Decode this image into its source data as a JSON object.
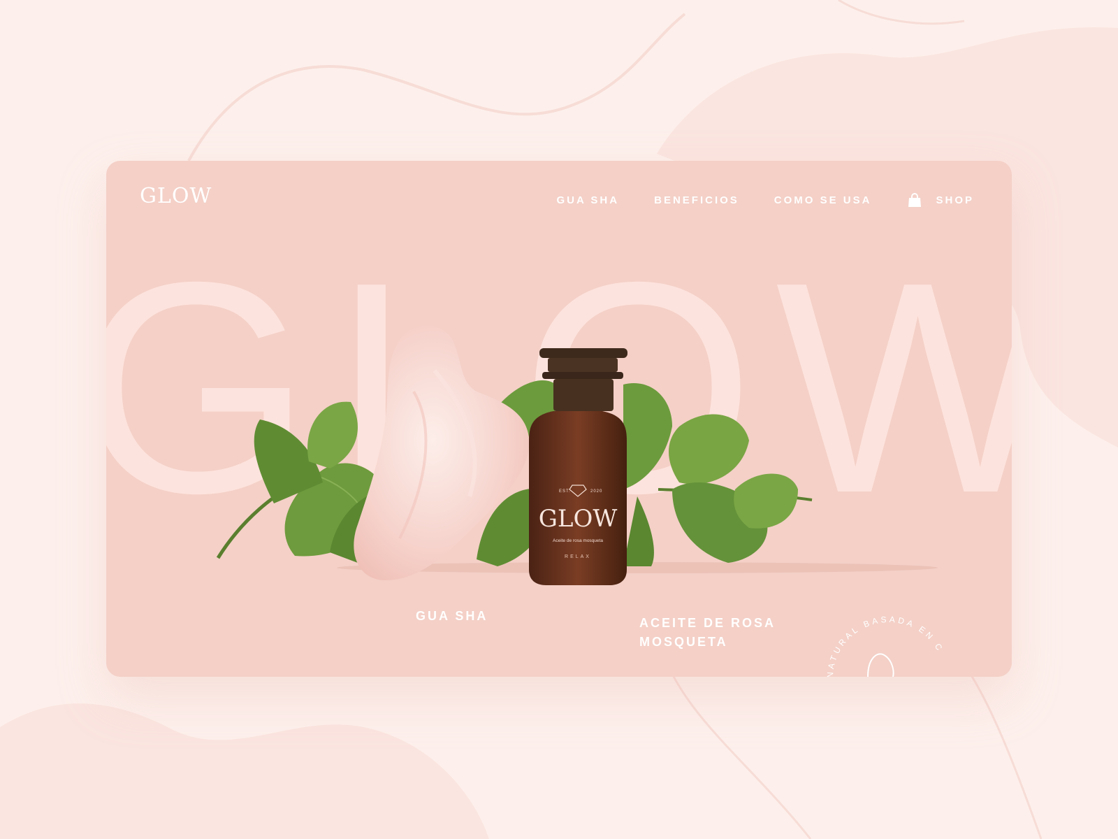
{
  "brand": {
    "logo": "GLOW"
  },
  "nav": {
    "items": [
      "GUA SHA",
      "BENEFICIOS",
      "COMO SE USA"
    ],
    "shop_label": "SHOP"
  },
  "hero": {
    "big_word": "GLOW",
    "bottle": {
      "est": "EST.",
      "year": "2020",
      "name": "GLOW",
      "subtitle": "Aceite de rosa mosqueta",
      "variant": "RELAX"
    }
  },
  "products": [
    {
      "label": "GUA SHA"
    },
    {
      "label": "ACEITE DE ROSA MOSQUETA"
    }
  ],
  "badge": {
    "text": "NATURAL BASADA EN C"
  },
  "colors": {
    "page_bg": "#fdf0ec",
    "card_bg": "#f4d0c7",
    "big_word": "#fde3dd",
    "text": "#ffffff",
    "bottle": "#6d3622",
    "leaf": "#6c9b3d",
    "stone": "#f7d9d3"
  },
  "icons": {
    "cart": "shopping-bag-icon"
  }
}
